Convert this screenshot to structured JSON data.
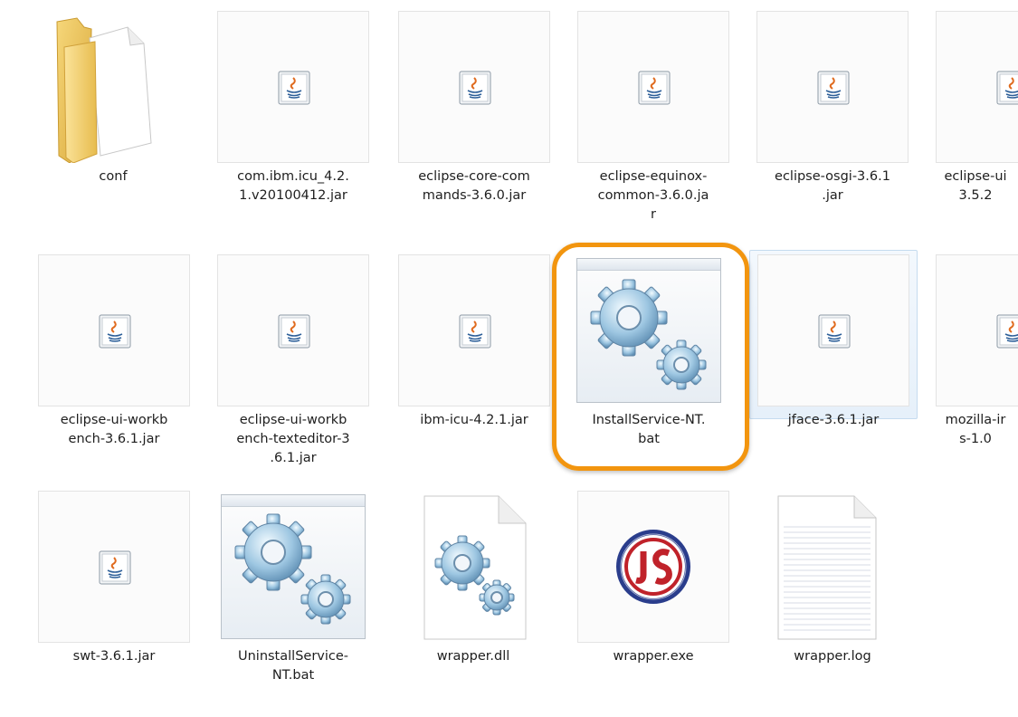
{
  "files": [
    {
      "name": "conf",
      "type": "folder"
    },
    {
      "name": "com.ibm.icu_4.2.\n1.v20100412.jar",
      "type": "jar"
    },
    {
      "name": "eclipse-core-com\nmands-3.6.0.jar",
      "type": "jar"
    },
    {
      "name": "eclipse-equinox-\ncommon-3.6.0.ja\nr",
      "type": "jar"
    },
    {
      "name": "eclipse-osgi-3.6.1\n.jar",
      "type": "jar"
    },
    {
      "name": "eclipse-ui\n3.5.2",
      "type": "jar"
    },
    {
      "name": "eclipse-ui-workb\nench-3.6.1.jar",
      "type": "jar"
    },
    {
      "name": "eclipse-ui-workb\nench-texteditor-3\n.6.1.jar",
      "type": "jar"
    },
    {
      "name": "ibm-icu-4.2.1.jar",
      "type": "jar"
    },
    {
      "name": "InstallService-NT.\nbat",
      "type": "bat",
      "state": "highlighted"
    },
    {
      "name": "jface-3.6.1.jar",
      "type": "jar",
      "state": "hovered"
    },
    {
      "name": "mozilla-ir\ns-1.0",
      "type": "jar"
    },
    {
      "name": "swt-3.6.1.jar",
      "type": "jar"
    },
    {
      "name": "UninstallService-\nNT.bat",
      "type": "bat"
    },
    {
      "name": "wrapper.dll",
      "type": "dll"
    },
    {
      "name": "wrapper.exe",
      "type": "exe"
    },
    {
      "name": "wrapper.log",
      "type": "log"
    }
  ],
  "icons": {
    "folder": "folder-icon",
    "jar": "java-jar-icon",
    "bat": "batch-gears-icon",
    "dll": "dll-gears-icon",
    "exe": "js-exe-icon",
    "log": "text-document-icon"
  },
  "colors": {
    "highlight": "#f2950f",
    "hover_border": "#c5dbef",
    "exe_red": "#c0222a",
    "exe_blue": "#1f3e8f"
  }
}
